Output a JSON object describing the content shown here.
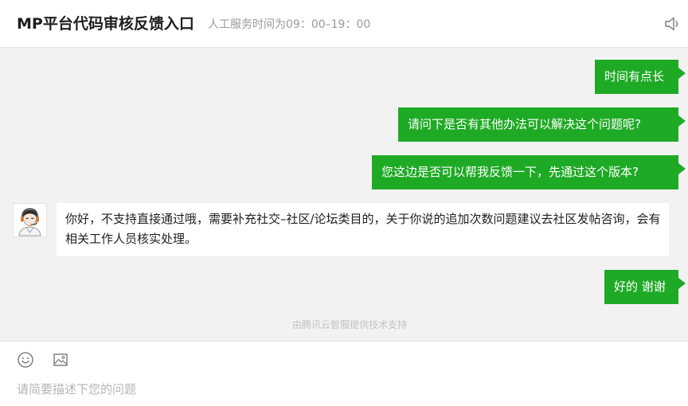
{
  "header": {
    "title": "MP平台代码审核反馈入口",
    "service_hours": "人工服务时间为09：00–19：00",
    "sound_icon": "speaker-icon"
  },
  "messages": [
    {
      "direction": "outgoing",
      "text": "时间有点长"
    },
    {
      "direction": "outgoing",
      "text": "请问下是否有其他办法可以解决这个问题呢?"
    },
    {
      "direction": "outgoing",
      "text": "您这边是否可以帮我反馈一下，先通过这个版本?"
    },
    {
      "direction": "incoming",
      "text": "你好，不支持直接通过哦，需要补充社交–社区/论坛类目的，关于你说的追加次数问题建议去社区发帖咨询，会有相关工作人员核实处理。"
    },
    {
      "direction": "outgoing",
      "text": "好的 谢谢"
    }
  ],
  "agent": {
    "avatar_icon": "customer-service-avatar-icon"
  },
  "footer_note": "由腾讯云智服提供技术支持",
  "composer": {
    "emoji_icon": "emoji-icon",
    "image_icon": "image-icon",
    "placeholder": "请简要描述下您的问题"
  },
  "colors": {
    "outgoing_bubble": "#1faa26",
    "chat_background": "#f2f2f2",
    "incoming_bubble": "#ffffff"
  }
}
